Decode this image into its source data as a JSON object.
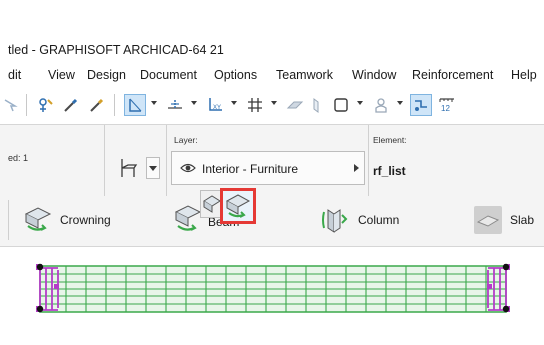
{
  "window": {
    "title": "tled - GRAPHISOFT ARCHICAD-64 21"
  },
  "menubar": {
    "items": [
      "dit",
      "View",
      "Design",
      "Document",
      "Options",
      "Teamwork",
      "Window",
      "Reinforcement",
      "Help"
    ]
  },
  "toolbar": {
    "icons": [
      "arrow-icon",
      "pick-up-icon",
      "eyedropper-icon",
      "inject-icon",
      "snap-guide-icon",
      "snap-points-icon",
      "xy-coordinate-icon",
      "grid-snap-icon",
      "surface-icon",
      "marquee-icon",
      "layout-view-icon",
      "user-icon",
      "renovation-icon",
      "dimension-icon"
    ]
  },
  "infobox": {
    "id_label": "ed: 1",
    "layer_label": "Layer:",
    "layer_value": "Interior - Furniture",
    "element_label": "Element:",
    "element_value": "rf_list"
  },
  "tools": {
    "crowning": "Crowning",
    "beam": "Beam",
    "column": "Column",
    "slab": "Slab"
  },
  "colors": {
    "highlight_border": "#e53935",
    "beam_green": "#3aa84a",
    "handle_purple": "#b43cc8"
  }
}
